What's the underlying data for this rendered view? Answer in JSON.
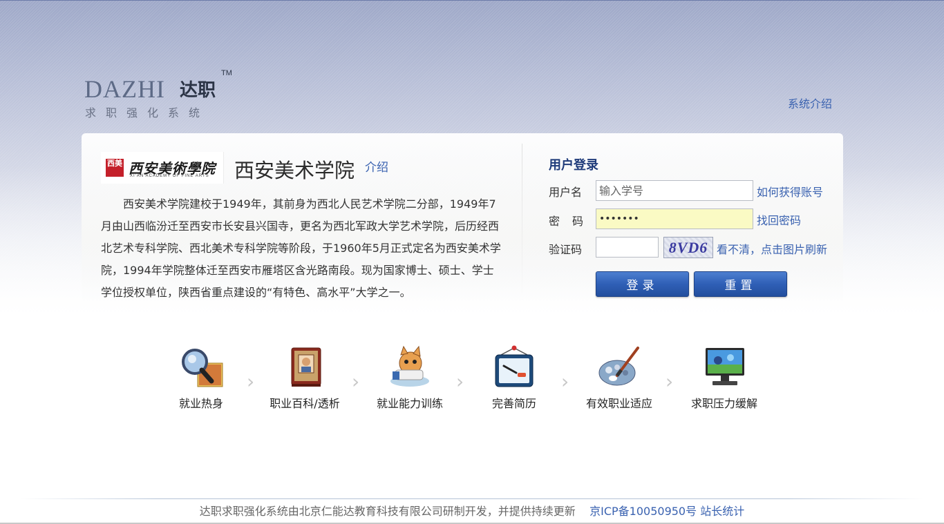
{
  "header": {
    "logo": {
      "brand_en": "DAZHI",
      "brand_cn": "达职",
      "trademark": "TM",
      "tagline": "求职强化系统"
    },
    "system_intro_link": "系统介绍"
  },
  "school": {
    "logo_seal": "西美",
    "logo_calligraphy": "西安美術學院",
    "logo_en": "XI'AN ACADEMY OF FINE ARTS",
    "name": "西安美术学院",
    "intro_link": "介绍",
    "description": "西安美术学院建校于1949年，其前身为西北人民艺术学院二分部，1949年7月由山西临汾迁至西安市长安县兴国寺，更名为西北军政大学艺术学院，后历经西北艺术专科学院、西北美术专科学院等阶段，于1960年5月正式定名为西安美术学院，1994年学院整体迁至西安市雁塔区含光路南段。现为国家博士、硕士、学士学位授权单位，陕西省重点建设的“有特色、高水平”大学之一。"
  },
  "login": {
    "title": "用户登录",
    "username_label": "用户名",
    "username_placeholder": "输入学号",
    "username_value": "",
    "get_account_link": "如何获得账号",
    "password_label": "密码",
    "password_value": "•••••••",
    "find_password_link": "找回密码",
    "captcha_label": "验证码",
    "captcha_value": "",
    "captcha_text": "8VD6",
    "refresh_link": "看不清，点击图片刷新",
    "login_button": "登录",
    "reset_button": "重置"
  },
  "steps": [
    {
      "label": "就业热身",
      "icon": "magnifier-icon"
    },
    {
      "label": "职业百科/透析",
      "icon": "book-icon"
    },
    {
      "label": "就业能力训练",
      "icon": "cartoon-icon"
    },
    {
      "label": "完善简历",
      "icon": "whiteboard-icon"
    },
    {
      "label": "有效职业适应",
      "icon": "palette-icon"
    },
    {
      "label": "求职压力缓解",
      "icon": "monitor-icon"
    }
  ],
  "step_arrow": "›",
  "footer": {
    "text": "达职求职强化系统由北京仁能达教育科技有限公司研制开发，并提供持续更新",
    "icp_link": "京ICP备10050950号",
    "stats_link": "站长统计"
  },
  "colors": {
    "link": "#3a62b0",
    "button": "#2f5fb6",
    "title": "#1f3b7a",
    "password_bg": "#fafac4"
  }
}
